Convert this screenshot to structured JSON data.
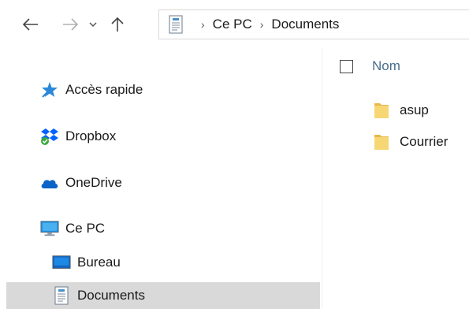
{
  "toolbar": {
    "back_icon": "arrow-left-icon",
    "forward_icon": "arrow-right-icon",
    "recent_icon": "chevron-down-icon",
    "up_icon": "arrow-up-icon"
  },
  "address": {
    "icon": "document-folder-icon",
    "crumbs": [
      "Ce PC",
      "Documents"
    ]
  },
  "nav": {
    "items": [
      {
        "label": "Accès rapide",
        "icon": "star-icon"
      },
      {
        "label": "Dropbox",
        "icon": "dropbox-icon"
      },
      {
        "label": "OneDrive",
        "icon": "cloud-icon"
      },
      {
        "label": "Ce PC",
        "icon": "computer-icon"
      },
      {
        "label": "Bureau",
        "icon": "desktop-icon"
      },
      {
        "label": "Documents",
        "icon": "documents-icon",
        "selected": true
      }
    ]
  },
  "content": {
    "column_header": "Nom",
    "files": [
      {
        "name": "asup",
        "icon": "folder-icon"
      },
      {
        "name": "Courrier",
        "icon": "folder-icon"
      }
    ]
  },
  "colors": {
    "selection": "#d9d9d9",
    "column_header": "#4a6d8c",
    "folder": "#f7d774",
    "accent_blue": "#0078d7"
  }
}
